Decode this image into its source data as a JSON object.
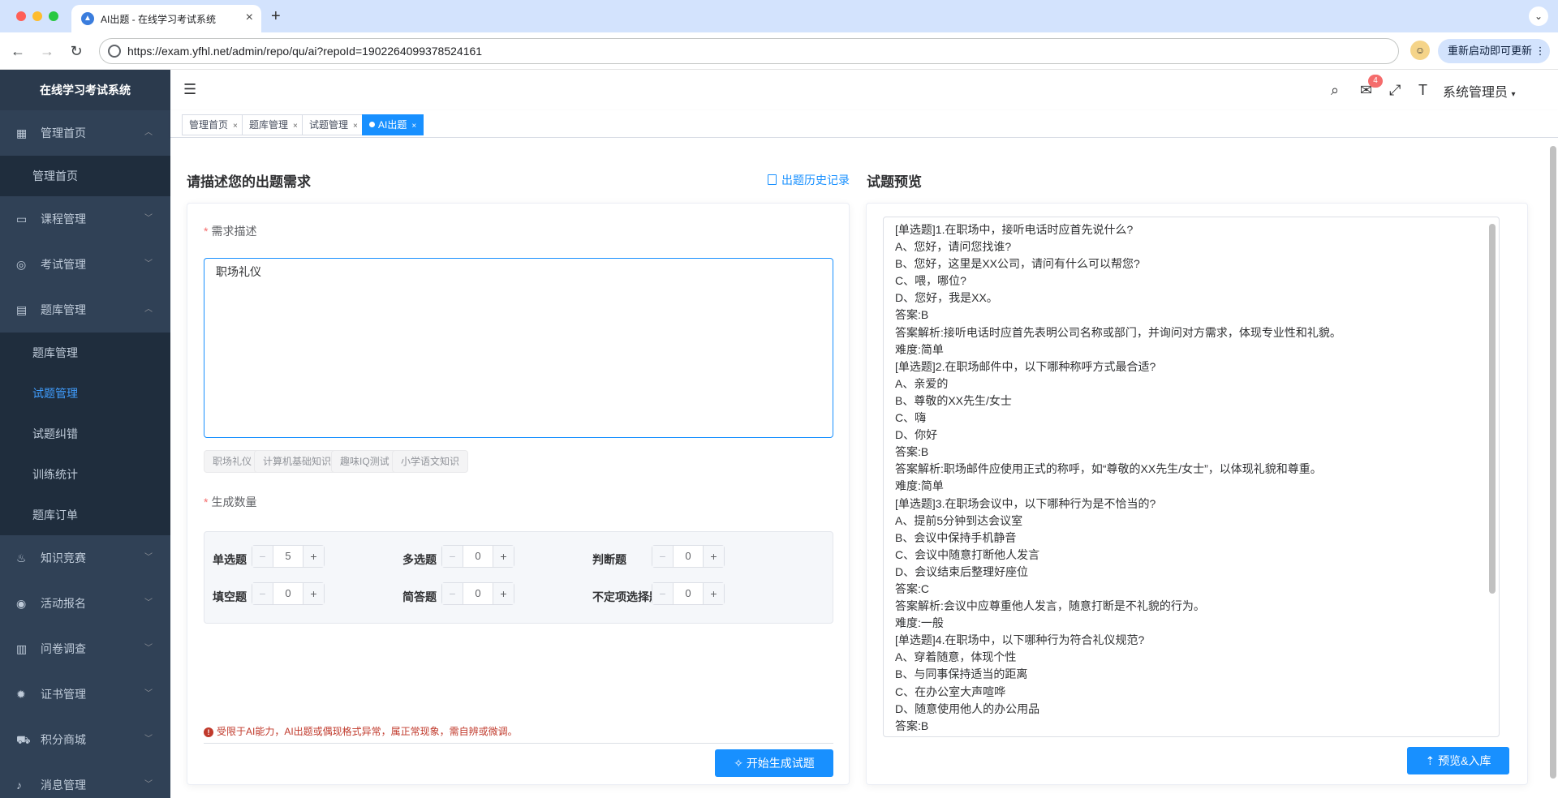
{
  "browser": {
    "tab_title": "AI出题 - 在线学习考试系统",
    "url": "https://exam.yfhl.net/admin/repo/qu/ai?repoId=1902264099378524161",
    "update_label": "重新启动即可更新"
  },
  "sidebar": {
    "brand": "在线学习考试系统",
    "menu": [
      {
        "label": "管理首页",
        "icon": "grid-icon",
        "expanded": true,
        "children": [
          "管理首页"
        ]
      },
      {
        "label": "课程管理",
        "icon": "monitor-icon"
      },
      {
        "label": "考试管理",
        "icon": "target-icon"
      },
      {
        "label": "题库管理",
        "icon": "document-icon",
        "expanded": true,
        "children": [
          "题库管理",
          "试题管理",
          "试题纠错",
          "训练统计",
          "题库订单"
        ],
        "active_child": "试题管理"
      },
      {
        "label": "知识竞赛",
        "icon": "flame-icon"
      },
      {
        "label": "活动报名",
        "icon": "disc-icon"
      },
      {
        "label": "问卷调查",
        "icon": "book-icon"
      },
      {
        "label": "证书管理",
        "icon": "gear-icon"
      },
      {
        "label": "积分商城",
        "icon": "cart-icon"
      },
      {
        "label": "消息管理",
        "icon": "bell-icon"
      }
    ]
  },
  "header": {
    "user": "系统管理员",
    "message_count": "4"
  },
  "tags": [
    {
      "label": "管理首页",
      "active": false
    },
    {
      "label": "题库管理",
      "active": false
    },
    {
      "label": "试题管理",
      "active": false
    },
    {
      "label": "AI出题",
      "active": true
    }
  ],
  "left": {
    "title": "请描述您的出题需求",
    "history_label": "出题历史记录",
    "desc_label": "需求描述",
    "desc_value": "职场礼仪",
    "chips": [
      "职场礼仪",
      "计算机基础知识",
      "趣味IQ测试",
      "小学语文知识"
    ],
    "count_label": "生成数量",
    "counts": [
      {
        "label": "单选题",
        "value": "5"
      },
      {
        "label": "多选题",
        "value": "0"
      },
      {
        "label": "判断题",
        "value": "0"
      },
      {
        "label": "填空题",
        "value": "0"
      },
      {
        "label": "简答题",
        "value": "0"
      },
      {
        "label": "不定项选择题",
        "value": "0"
      }
    ],
    "warning": "受限于AI能力，AI出题或偶现格式异常，属正常现象，需自辨或微调。",
    "generate_label": "开始生成试题"
  },
  "right": {
    "title": "试题预览",
    "preview_lines": [
      "[单选题]1.在职场中，接听电话时应首先说什么?",
      "A、您好，请问您找谁?",
      "B、您好，这里是XX公司，请问有什么可以帮您?",
      "C、喂，哪位?",
      "D、您好，我是XX。",
      "答案:B",
      "答案解析:接听电话时应首先表明公司名称或部门，并询问对方需求，体现专业性和礼貌。",
      "难度:简单",
      "[单选题]2.在职场邮件中，以下哪种称呼方式最合适?",
      "A、亲爱的",
      "B、尊敬的XX先生/女士",
      "C、嗨",
      "D、你好",
      "答案:B",
      "答案解析:职场邮件应使用正式的称呼，如“尊敬的XX先生/女士”，以体现礼貌和尊重。",
      "难度:简单",
      "[单选题]3.在职场会议中，以下哪种行为是不恰当的?",
      "A、提前5分钟到达会议室",
      "B、会议中保持手机静音",
      "C、会议中随意打断他人发言",
      "D、会议结束后整理好座位",
      "答案:C",
      "答案解析:会议中应尊重他人发言，随意打断是不礼貌的行为。",
      "难度:一般",
      "[单选题]4.在职场中，以下哪种行为符合礼仪规范?",
      "A、穿着随意，体现个性",
      "B、与同事保持适当的距离",
      "C、在办公室大声喧哗",
      "D、随意使用他人的办公用品",
      "答案:B"
    ],
    "submit_label": "预览&入库"
  }
}
